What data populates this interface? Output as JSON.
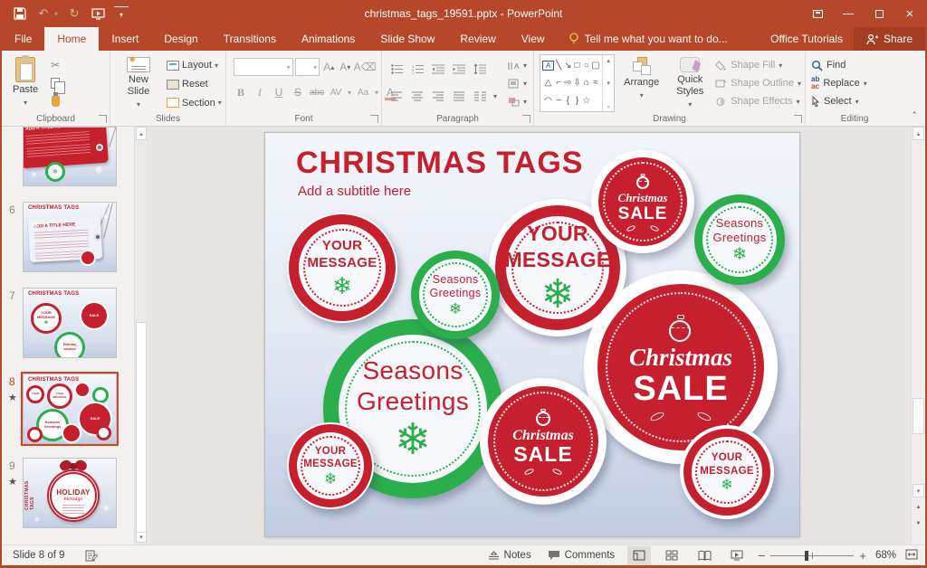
{
  "window": {
    "title": "christmas_tags_19591.pptx - PowerPoint"
  },
  "icons": {
    "dropdown": "▾",
    "up": "▴",
    "down": "▾",
    "scrollbar_more": "⌄",
    "undo": "↶",
    "repeat": "↻",
    "scissors": "✂",
    "star": "★",
    "snowflake": "❄",
    "close": "×",
    "dbl_up": "▲",
    "dbl_down": "▼"
  },
  "tabs": [
    {
      "label": "File"
    },
    {
      "label": "Home"
    },
    {
      "label": "Insert"
    },
    {
      "label": "Design"
    },
    {
      "label": "Transitions"
    },
    {
      "label": "Animations"
    },
    {
      "label": "Slide Show"
    },
    {
      "label": "Review"
    },
    {
      "label": "View"
    }
  ],
  "tell_me": "Tell me what you want to do...",
  "top_right": {
    "office_tutorials": "Office Tutorials",
    "share": "Share"
  },
  "ribbon": {
    "clipboard": {
      "group_label": "Clipboard",
      "paste": "Paste"
    },
    "slides": {
      "group_label": "Slides",
      "new_slide": "New Slide",
      "layout": "Layout",
      "reset": "Reset",
      "section": "Section"
    },
    "font": {
      "group_label": "Font",
      "bold": "B",
      "italic": "I",
      "underline": "U",
      "strike": "S",
      "abc": "abc",
      "av": "AV",
      "aa": "Aa",
      "grow": "A",
      "shrink": "A",
      "color": "A",
      "clear": "A"
    },
    "paragraph": {
      "group_label": "Paragraph"
    },
    "drawing": {
      "group_label": "Drawing",
      "arrange": "Arrange",
      "quick_styles": "Quick Styles",
      "shape_fill": "Shape Fill",
      "shape_outline": "Shape Outline",
      "shape_effects": "Shape Effects",
      "textbox_glyph": "A",
      "shapes": [
        "╲",
        "↘",
        "□",
        "○",
        "▢",
        "△",
        "⌐",
        "⇨",
        "⇩",
        "⌂",
        "≈",
        "◠",
        "~",
        "{",
        "}",
        "☆"
      ]
    },
    "editing": {
      "group_label": "Editing",
      "find": "Find",
      "replace": "Replace",
      "select": "Select"
    }
  },
  "thumbnails": {
    "nums": {
      "n5": "5",
      "n6": "6",
      "n7": "7",
      "n8": "8",
      "n9": "9"
    },
    "t5": {
      "tag_title": "ADD A TITLE HERE"
    },
    "t6": {
      "slide_title": "CHRISTMAS TAGS",
      "tag_title": "ADD A TITLE HERE"
    },
    "t7": {
      "slide_title": "CHRISTMAS TAGS",
      "c1a": "YOUR",
      "c1b": "MESSAGE",
      "c2": "SALE",
      "c3a": "Holiday",
      "c3b": "wishes"
    },
    "t8": {
      "slide_title": "CHRISTMAS TAGS",
      "your": "YOUR",
      "message": "MESSAGE",
      "sale": "SALE",
      "seasons": "Seasons",
      "greetings": "Greetings"
    },
    "t9": {
      "side_title": "CHRISTMAS TAGS",
      "line1": "HOLIDAY",
      "line2": "message"
    }
  },
  "slide": {
    "title": "CHRISTMAS TAGS",
    "subtitle": "Add a subtitle here",
    "badges": {
      "b1": {
        "l1": "YOUR",
        "l2": "MESSAGE"
      },
      "b2": {
        "l1": "Seasons",
        "l2": "Greetings"
      },
      "b3": {
        "l1": "YOUR",
        "l2": "MESSAGE"
      },
      "b4": {
        "script": "Christmas",
        "sale": "SALE"
      },
      "b5": {
        "l1": "Seasons",
        "l2": "Greetings"
      },
      "b6": {
        "script": "Christmas",
        "sale": "SALE"
      },
      "b7": {
        "l1": "Seasons",
        "l2": "Greetings"
      },
      "b8": {
        "l1": "YOUR",
        "l2": "MESSAGE"
      },
      "b9": {
        "script": "Christmas",
        "sale": "SALE"
      },
      "b10": {
        "l1": "YOUR",
        "l2": "MESSAGE"
      }
    }
  },
  "status": {
    "counter": "Slide 8 of 9",
    "notes": "Notes",
    "comments": "Comments",
    "zoom_level": "68%"
  },
  "colors": {
    "titlebar": "#B7472A",
    "accent_red": "#C6202E",
    "accent_green": "#2BAF4D"
  }
}
